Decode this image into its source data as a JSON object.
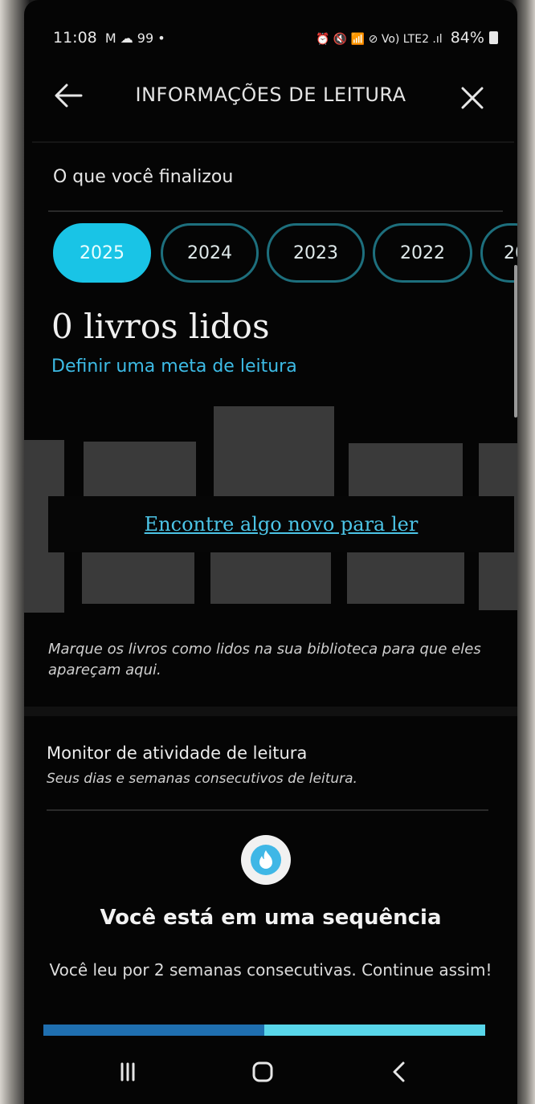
{
  "status_bar": {
    "time": "11:08",
    "notif_icons": "M ☁ 99 •",
    "system_icons": "⏰ 🔇 📶 ⊘ Vo) LTE2 .ıl",
    "battery": "84%"
  },
  "header": {
    "title": "INFORMAÇÕES DE LEITURA"
  },
  "finished": {
    "title": "O que você finalizou",
    "years": [
      {
        "label": "2025",
        "selected": true
      },
      {
        "label": "2024",
        "selected": false
      },
      {
        "label": "2023",
        "selected": false
      },
      {
        "label": "2022",
        "selected": false
      },
      {
        "label": "20",
        "selected": false
      }
    ],
    "count_label": "0 livros lidos",
    "goal_link": "Definir uma meta de leitura",
    "find_link": "Encontre algo novo para ler",
    "hint": "Marque os livros como lidos na sua biblioteca para que eles apareçam aqui."
  },
  "monitor": {
    "title": "Monitor de atividade de leitura",
    "subtitle": "Seus dias e semanas consecutivos de leitura.",
    "streak_title": "Você está em uma sequência",
    "streak_desc": "Você leu por 2 semanas consecutivas. Continue assim!",
    "progress_fraction": 0.5
  },
  "icons": {
    "back": "arrow-left-icon",
    "close": "close-icon",
    "flame": "flame-icon",
    "recents": "recents-icon",
    "home": "home-icon",
    "nav_back": "chevron-left-icon"
  },
  "colors": {
    "accent": "#19c4e6",
    "link": "#3dbbe5",
    "background": "#050505"
  }
}
